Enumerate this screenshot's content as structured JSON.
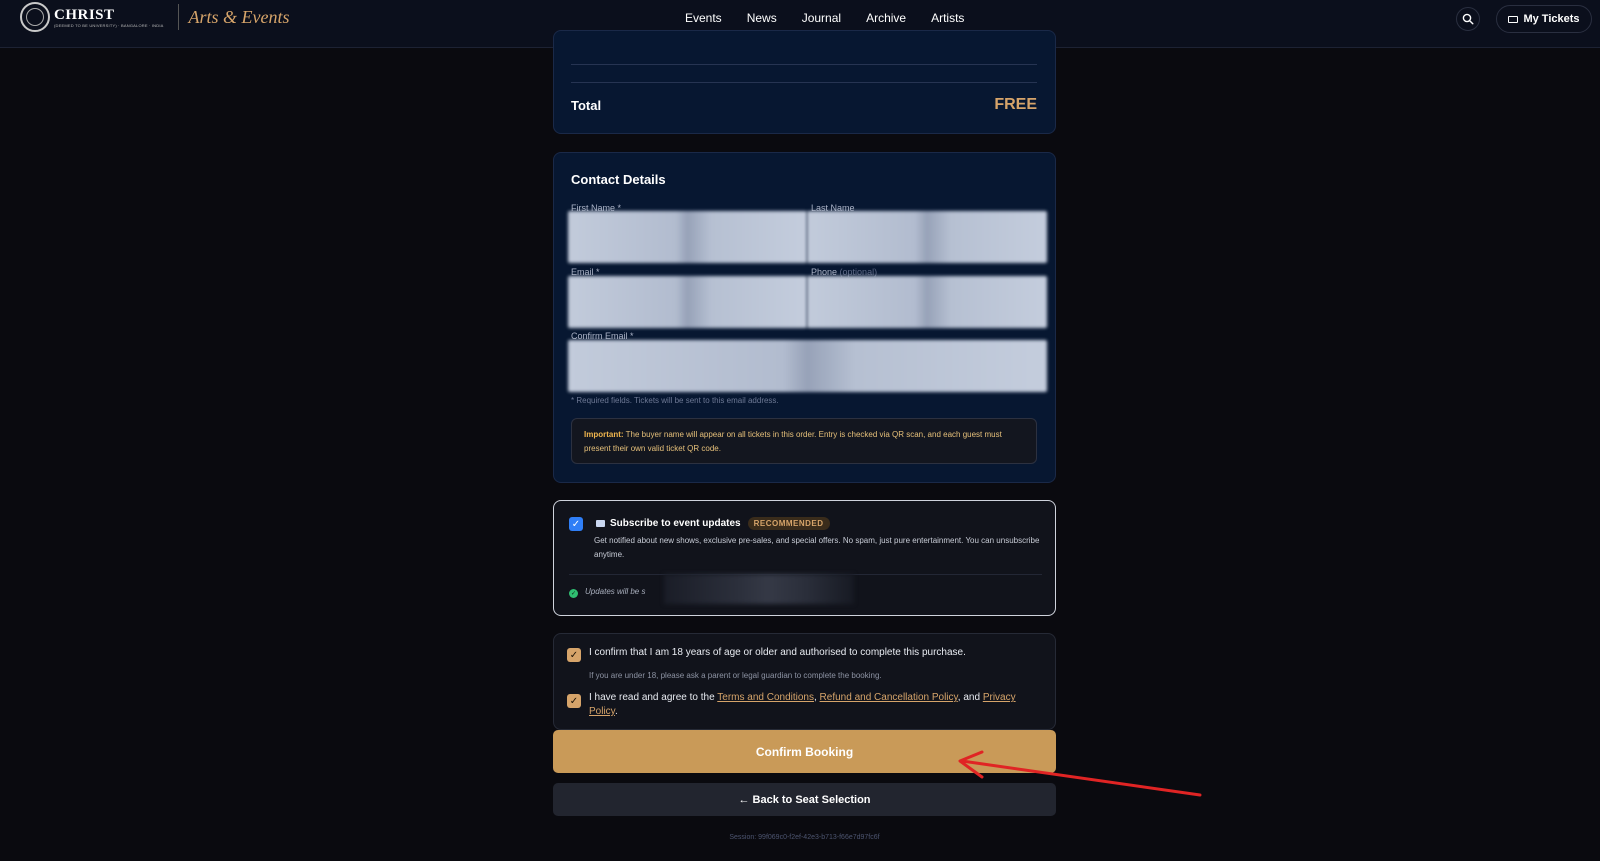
{
  "header": {
    "logo_text": "CHRIST",
    "logo_sub": "(DEEMED TO BE UNIVERSITY) · BANGALORE · INDIA",
    "brand": "Arts & Events",
    "nav": [
      "Events",
      "News",
      "Journal",
      "Archive",
      "Artists"
    ],
    "my_tickets": "My Tickets"
  },
  "summary": {
    "total_label": "Total",
    "total_value": "FREE"
  },
  "contact": {
    "title": "Contact Details",
    "first_name_label": "First Name *",
    "last_name_label": "Last Name",
    "email_label": "Email *",
    "phone_label": "Phone",
    "phone_optional": "(optional)",
    "confirm_email_label": "Confirm Email *",
    "helper": "* Required fields. Tickets will be sent to this email address.",
    "important_label": "Important:",
    "important_text": "The buyer name will appear on all tickets in this order. Entry is checked via QR scan, and each guest must present their own valid ticket QR code."
  },
  "subscribe": {
    "title": "Subscribe to event updates",
    "badge": "RECOMMENDED",
    "description": "Get notified about new shows, exclusive pre-sales, and special offers. No spam, just pure entertainment. You can unsubscribe anytime.",
    "updates_text": "Updates will be s",
    "checked": true
  },
  "terms": {
    "age_confirm": "I confirm that I am 18 years of age or older and authorised to complete this purchase.",
    "age_note": "If you are under 18, please ask a parent or legal guardian to complete the booking.",
    "agree_prefix": "I have read and agree to the",
    "terms_link": "Terms and Conditions",
    "refund_link": "Refund and Cancellation Policy",
    "and_text": ", and",
    "privacy_link": "Privacy Policy",
    "age_checked": true,
    "agree_checked": true
  },
  "actions": {
    "confirm_label": "Confirm Booking",
    "back_label": "← Back to Seat Selection"
  },
  "session": "Session: 99f069c0-f2ef-42e3-b713-f66e7d97fc6f",
  "colors": {
    "accent": "#d6a46a",
    "primary_button": "#c99a58",
    "card_bg": "#071731",
    "check_blue": "#2f7ef6",
    "annotation_arrow": "#e02424"
  }
}
